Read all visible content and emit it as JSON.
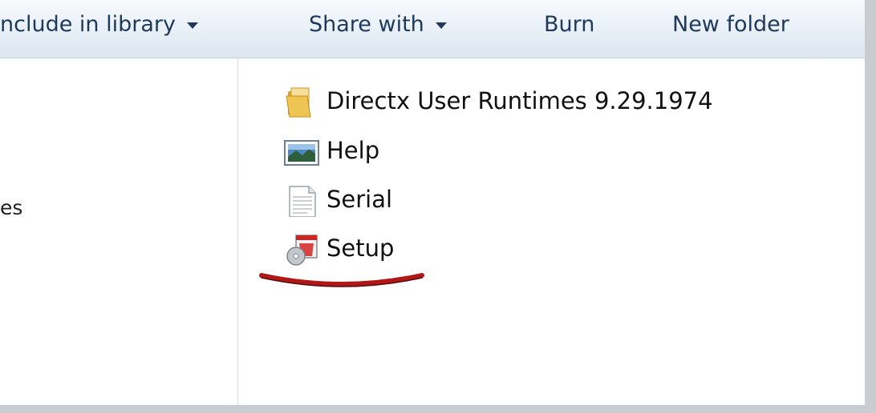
{
  "toolbar": {
    "include_in_library": "nclude in library",
    "share_with": "Share with",
    "burn": "Burn",
    "new_folder": "New folder"
  },
  "nav_pane": {
    "partial_text": "es"
  },
  "files": [
    {
      "name": "Directx User Runtimes 9.29.1974",
      "icon": "folder-icon"
    },
    {
      "name": "Help",
      "icon": "image-file-icon"
    },
    {
      "name": "Serial",
      "icon": "text-file-icon"
    },
    {
      "name": "Setup",
      "icon": "setup-installer-icon"
    }
  ],
  "colors": {
    "toolbar_text": "#1e395b",
    "annotation_underline": "#b01818"
  }
}
